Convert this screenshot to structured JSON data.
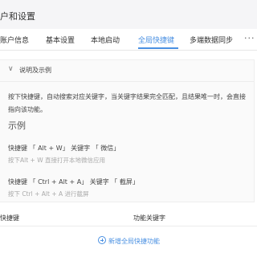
{
  "window": {
    "title": "户和设置"
  },
  "tabs": [
    {
      "label": "账户信息"
    },
    {
      "label": "基本设置"
    },
    {
      "label": "本地启动"
    },
    {
      "label": "全局快捷键",
      "active": true
    },
    {
      "label": "多端数据同步"
    }
  ],
  "overflow_icon": "more-horizontal-icon",
  "accent_color": "#4a90e2",
  "panel": {
    "collapse_label": "说明及示例",
    "description": "按下快捷键，自动搜索对应关键字，当关键字结果完全匹配，且结果唯一时，会直接指向该功能。",
    "example_heading": "示例",
    "examples": [
      {
        "title": "快捷键 「 Alt + W」 关键字 「 微信」",
        "sub": "按下Alt + W 直接打开本地微信应用"
      },
      {
        "title": "快捷键 「 Ctrl + Alt + A」 关键字 「 截屏」",
        "sub": "按下 Ctrl + Alt + A 进行截屏"
      }
    ]
  },
  "table": {
    "col_shortcut": "快捷键",
    "col_keyword": "功能关键字"
  },
  "add_button": {
    "label": "新增全局快捷功能",
    "icon": "plus-circle-icon"
  }
}
